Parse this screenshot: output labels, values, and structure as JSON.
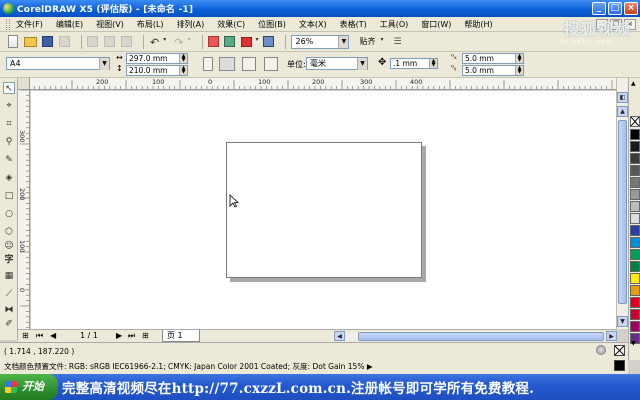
{
  "window": {
    "title": "CorelDRAW X5 (评估版) - [未命名 -1]",
    "min": "_",
    "max": "□",
    "close": "×"
  },
  "menu": {
    "items": [
      "文件(F)",
      "编辑(E)",
      "视图(V)",
      "布局(L)",
      "排列(A)",
      "效果(C)",
      "位图(B)",
      "文本(X)",
      "表格(T)",
      "工具(O)",
      "窗口(W)",
      "帮助(H)"
    ]
  },
  "toolbar": {
    "zoom": "26%",
    "snap_label": "贴齐"
  },
  "watermark": {
    "logo": "搜狐视频",
    "url": "tv.sohu.com"
  },
  "property_bar": {
    "page_size": "A4",
    "width": "297.0 mm",
    "height": "210.0 mm",
    "units_label": "单位:",
    "units_value": "毫米",
    "nudge": ".1 mm",
    "dup_x": "5.0 mm",
    "dup_y": "5.0 mm"
  },
  "rulers": {
    "h_labels": [
      "200",
      "100",
      "0",
      "100",
      "200",
      "300",
      "400"
    ],
    "v_labels": [
      "300",
      "200",
      "100",
      "0",
      "-100"
    ]
  },
  "page_nav": {
    "counter": "1 / 1",
    "page_tab": "页 1"
  },
  "status": {
    "coords": "( 1.714 , 187.220 )",
    "color_profile": "文档颜色预置文件: RGB: sRGB IEC61966-2.1; CMYK: Japan Color 2001 Coated; 灰度: Dot Gain 15% ▶"
  },
  "taskbar": {
    "start": "开始",
    "banner": "完整高清视频尽在http://77.cxzzL.com.cn.注册帐号即可学所有免费教程."
  },
  "palette_colors": [
    "#ffffff",
    "#000000",
    "#1a1a1a",
    "#3a3a3a",
    "#555555",
    "#777777",
    "#999999",
    "#bbbbbb",
    "#dddddd",
    "#2a3ca8",
    "#0090d8",
    "#00a050",
    "#008040",
    "#ffee00",
    "#e8a000",
    "#e00020",
    "#c80030",
    "#a00060",
    "#6a2a8a"
  ]
}
